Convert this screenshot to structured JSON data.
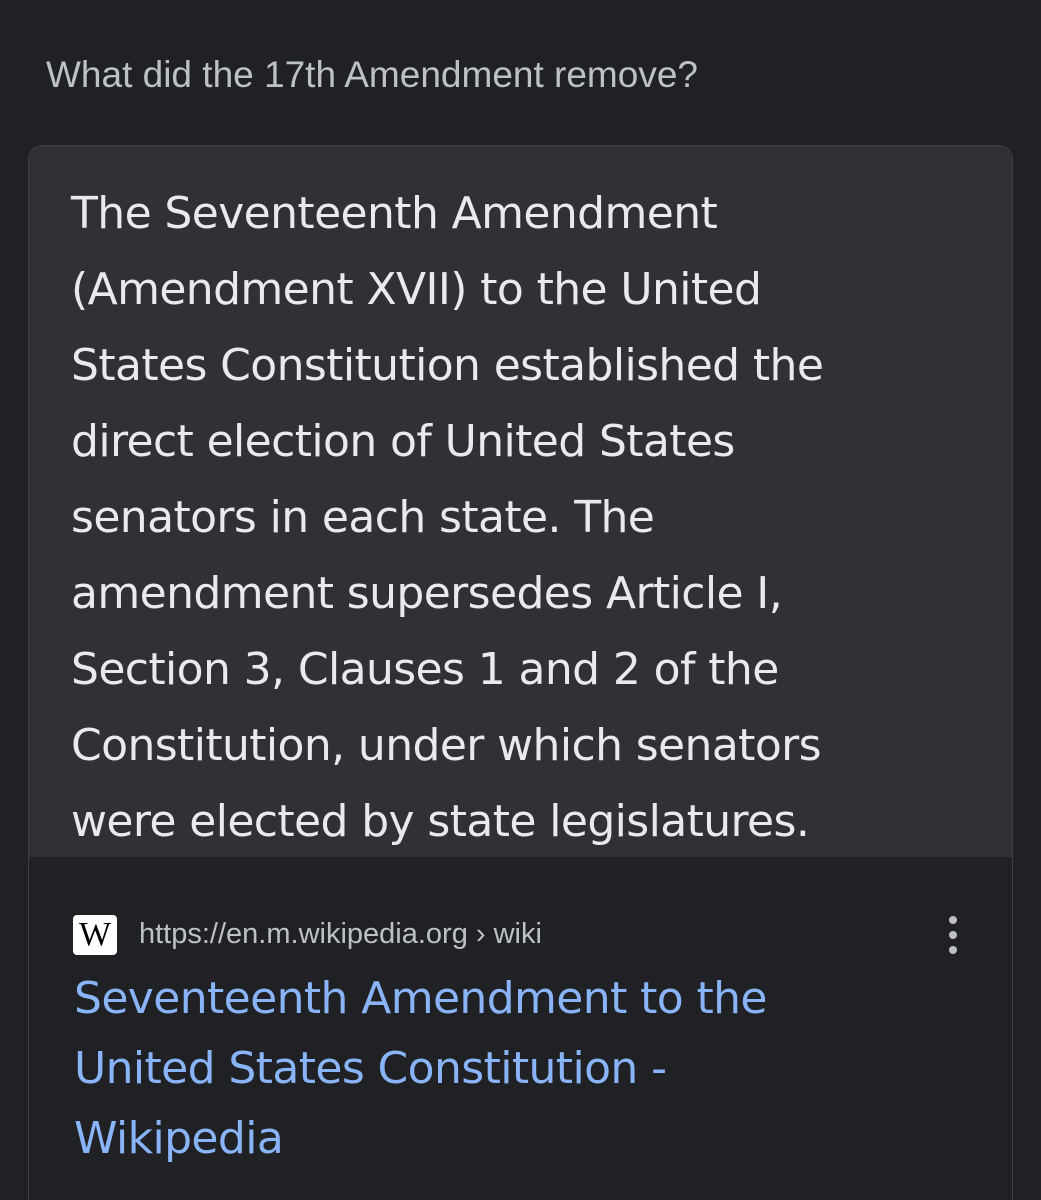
{
  "question": "What did the 17th Amendment remove?",
  "snippet": {
    "text": "The Seventeenth Amendment\n(Amendment XVII) to the United\nStates Constitution established the\ndirect election of United States\nsenators in each state. The\namendment supersedes Article I,\nSection 3, Clauses 1 and 2 of the\nConstitution, under which senators\nwere elected by state legislatures."
  },
  "result": {
    "favicon_letter": "W",
    "url": "https://en.m.wikipedia.org › wiki",
    "title": "Seventeenth Amendment to the\nUnited States Constitution -\nWikipedia",
    "menu_icon": "more-vert-icon"
  },
  "colors": {
    "background": "#202124",
    "snippet_background": "#303134",
    "text": "#e8eaed",
    "secondary_text": "#bdc1c6",
    "link": "#8ab4f8"
  }
}
